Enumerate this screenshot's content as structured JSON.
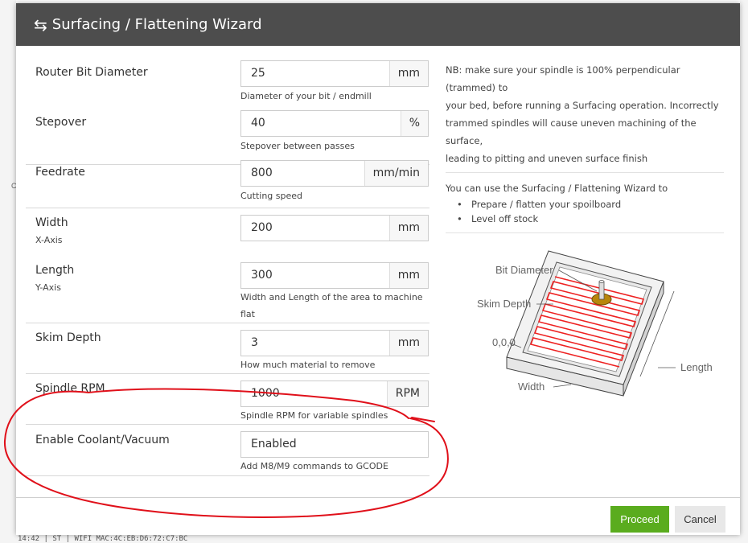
{
  "dialog": {
    "title": "Surfacing / Flattening Wizard",
    "title_icon": "swap-arrows-icon"
  },
  "form": {
    "router_bit_diameter": {
      "label": "Router Bit Diameter",
      "value": "25",
      "unit": "mm",
      "help": "Diameter of your bit / endmill"
    },
    "stepover": {
      "label": "Stepover",
      "value": "40",
      "unit": "%",
      "help": "Stepover between passes"
    },
    "feedrate": {
      "label": "Feedrate",
      "value": "800",
      "unit": "mm/min",
      "help": "Cutting speed"
    },
    "width": {
      "label": "Width",
      "sublabel": "X-Axis",
      "value": "200",
      "unit": "mm"
    },
    "length": {
      "label": "Length",
      "sublabel": "Y-Axis",
      "value": "300",
      "unit": "mm",
      "help_line1": "Width and Length of the area to machine",
      "help_line2": "flat"
    },
    "skim_depth": {
      "label": "Skim Depth",
      "value": "3",
      "unit": "mm",
      "help": "How much material to remove"
    },
    "spindle_rpm": {
      "label": "Spindle RPM",
      "value": "1000",
      "unit": "RPM",
      "help": "Spindle RPM for variable spindles"
    },
    "coolant": {
      "label": "Enable Coolant/Vacuum",
      "value": "Enabled",
      "help": "Add M8/M9 commands to GCODE"
    }
  },
  "notes": {
    "line1": "NB: make sure your spindle is 100% perpendicular (trammed) to",
    "line2": "your bed, before running a Surfacing operation. Incorrectly",
    "line3": "trammed spindles will cause uneven machining of the surface,",
    "line4": "leading to pitting and uneven surface finish",
    "intro": "You can use the Surfacing / Flattening Wizard to",
    "uses": [
      "Prepare / flatten your spoilboard",
      "Level off stock"
    ]
  },
  "diagram": {
    "bit_diameter": "Bit Diameter",
    "skim_depth": "Skim Depth",
    "origin": "0,0,0",
    "width": "Width",
    "length": "Length"
  },
  "buttons": {
    "proceed": "Proceed",
    "cancel": "Cancel"
  },
  "colors": {
    "titlebar": "#4d4d4d",
    "proceed": "#5aac1e",
    "annotation": "#e0101a",
    "toolpath": "#ee2222"
  },
  "background": {
    "status_bar": "14:42 | ST | WIFI MAC:4C:EB:D6:72:C7:BC"
  }
}
